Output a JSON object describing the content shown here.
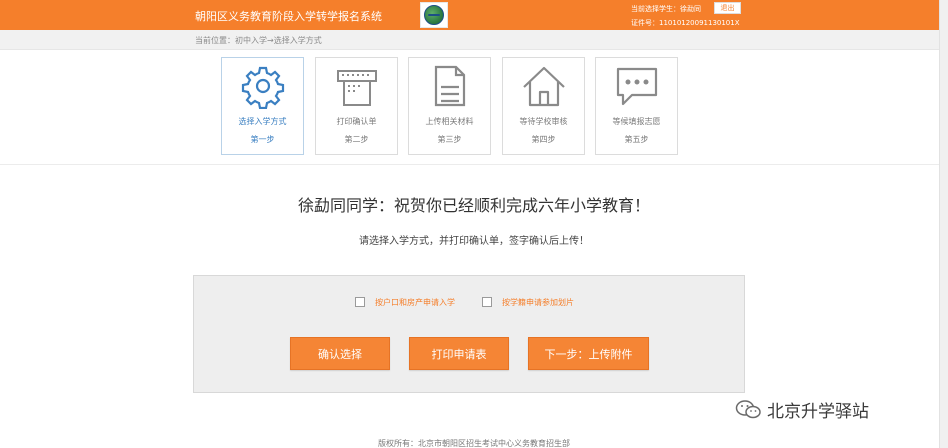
{
  "header": {
    "system_title": "朝阳区义务教育阶段入学转学报名系统",
    "current_student": "当前选择学生：徐勐同",
    "logout_label": "退出",
    "certificate": "证件号：11010120091130101X"
  },
  "breadcrumb": {
    "text": "当前位置：初中入学→选择入学方式"
  },
  "steps": [
    {
      "label": "选择入学方式",
      "step": "第一步",
      "icon": "gear-icon",
      "active": true
    },
    {
      "label": "打印确认单",
      "step": "第二步",
      "icon": "printer-icon",
      "active": false
    },
    {
      "label": "上传相关材料",
      "step": "第三步",
      "icon": "document-icon",
      "active": false
    },
    {
      "label": "等待学校审核",
      "step": "第四步",
      "icon": "home-icon",
      "active": false
    },
    {
      "label": "等候填报志愿",
      "step": "第五步",
      "icon": "chat-icon",
      "active": false
    }
  ],
  "main": {
    "congrats": "徐勐同同学：祝贺你已经顺利完成六年小学教育！",
    "instruction": "请选择入学方式，并打印确认单，签字确认后上传！"
  },
  "options": {
    "option1": "按户口和房产申请入学",
    "option2": "按学籍申请参加划片"
  },
  "buttons": {
    "confirm": "确认选择",
    "print": "打印申请表",
    "next": "下一步：上传附件"
  },
  "watermark": {
    "text": "北京升学驿站"
  },
  "footer": {
    "text": "版权所有：北京市朝阳区招生考试中心义务教育招生部"
  },
  "colors": {
    "brand": "#f57f2b",
    "active_step": "#3a7fc1",
    "button": "#f58535"
  }
}
